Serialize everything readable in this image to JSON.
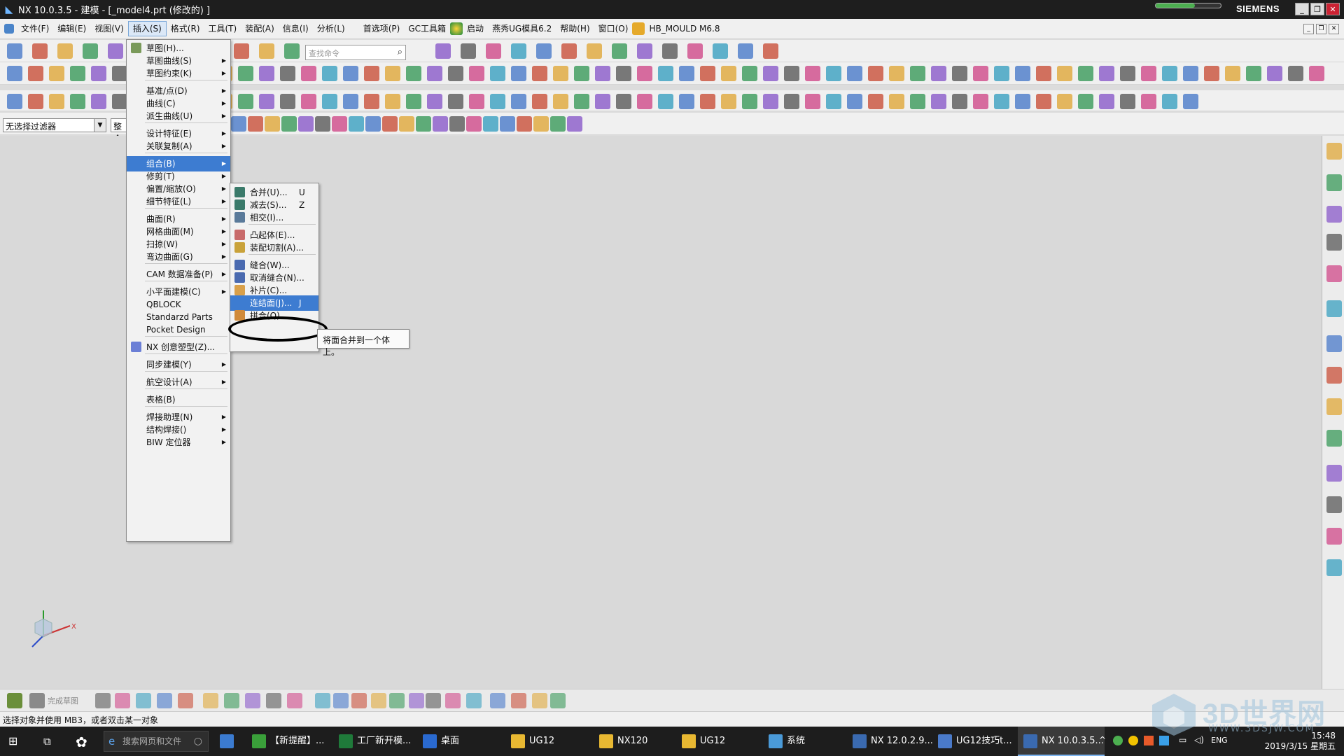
{
  "titlebar": {
    "title": "NX 10.0.3.5 - 建模 - [_model4.prt  (修改的)  ]",
    "brand": "SIEMENS"
  },
  "menubar": {
    "items": [
      "文件(F)",
      "编辑(E)",
      "视图(V)",
      "插入(S)",
      "格式(R)",
      "工具(T)",
      "装配(A)",
      "信息(I)",
      "分析(L)",
      "首选项(P)",
      "GC工具箱",
      "启动",
      "燕秀UG模具6.2",
      "帮助(H)",
      "窗口(O)",
      "HB_MOULD M6.8"
    ]
  },
  "toolbar": {
    "search_placeholder": "查找命令"
  },
  "selection_bar": {
    "filter": "无选择过滤器",
    "scope": "整个"
  },
  "insert_menu": {
    "items": [
      "草图(H)...",
      "草图曲线(S)",
      "草图约束(K)",
      "基准/点(D)",
      "曲线(C)",
      "派生曲线(U)",
      "设计特征(E)",
      "关联复制(A)",
      "组合(B)",
      "修剪(T)",
      "偏置/缩放(O)",
      "细节特征(L)",
      "曲面(R)",
      "网格曲面(M)",
      "扫掠(W)",
      "弯边曲面(G)",
      "CAM 数据准备(P)",
      "小平面建模(C)",
      "QBLOCK",
      "Standarzd Parts",
      "Pocket Design",
      "NX 创意塑型(Z)...",
      "同步建模(Y)",
      "航空设计(A)",
      "表格(B)",
      "焊接助理(N)",
      "结构焊接()",
      "BIW 定位器"
    ]
  },
  "combine_submenu": {
    "items": [
      {
        "label": "合并(U)...",
        "key": "U"
      },
      {
        "label": "减去(S)...",
        "key": "Z"
      },
      {
        "label": "相交(I)...",
        "key": ""
      },
      {
        "label": "凸起体(E)...",
        "key": ""
      },
      {
        "label": "装配切割(A)...",
        "key": ""
      },
      {
        "label": "缝合(W)...",
        "key": ""
      },
      {
        "label": "取消缝合(N)...",
        "key": ""
      },
      {
        "label": "补片(C)...",
        "key": ""
      },
      {
        "label": "连结面(J)...",
        "key": "J"
      },
      {
        "label": "拼合(Q)...",
        "key": ""
      }
    ]
  },
  "tooltip": "将面合并到一个体上。",
  "bottom_toolbar": {
    "finish_sketch": "完成草图"
  },
  "status": {
    "message": "选择对象并使用 MB3，或者双击某一对象"
  },
  "taskbar": {
    "search_placeholder": "搜索网页和文件",
    "tasks": [
      "【新提醒】...",
      "工厂新开模...",
      "桌面",
      "UG12",
      "NX120",
      "UG12",
      "系统",
      "NX 12.0.2.9...",
      "UG12技巧t...",
      "NX 10.0.3.5..."
    ],
    "lang": "ENG",
    "time": "15:48",
    "date": "2019/3/15 星期五"
  },
  "watermark": {
    "text": "3D世界网",
    "url": "WWW.3DSJW.COM"
  },
  "colors": {
    "highlight": "#3d7cd1",
    "titlebar": "#1e1e1e",
    "taskbar": "#1d1d1d",
    "canvas": "#d9d9d9"
  }
}
